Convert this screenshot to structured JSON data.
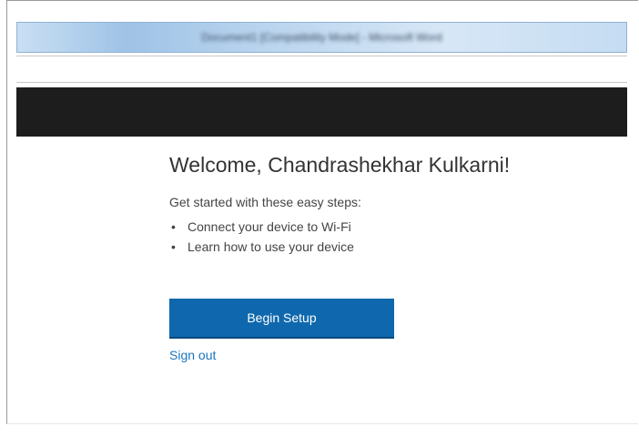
{
  "window": {
    "title": "Document1 [Compatibility Mode] - Microsoft Word"
  },
  "main": {
    "welcome_heading": "Welcome, Chandrashekhar Kulkarni!",
    "steps_intro": "Get started with these easy steps:",
    "steps": [
      "Connect your device to Wi-Fi",
      "Learn how to use your device"
    ],
    "bullet_glyph": "•",
    "begin_setup_label": "Begin Setup",
    "sign_out_label": "Sign out"
  },
  "colors": {
    "primary_button": "#0f68ad",
    "link": "#1b76bc",
    "header_band": "#1d1d1d"
  }
}
